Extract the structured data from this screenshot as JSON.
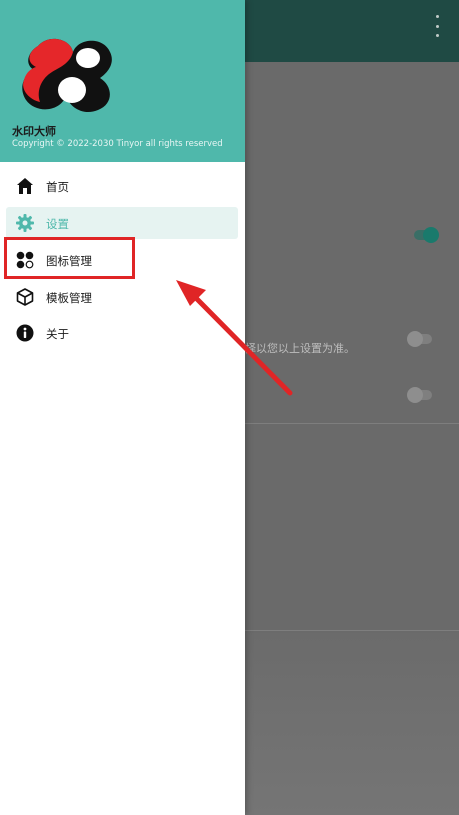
{
  "background": {
    "description_text": "择以您以上设置为准。"
  },
  "drawer": {
    "app_name": "水印大师",
    "copyright": "Copyright © 2022-2030 Tinyor all rights reserved",
    "menu": [
      {
        "label": "首页",
        "icon": "home-icon",
        "active": false
      },
      {
        "label": "设置",
        "icon": "gear-icon",
        "active": true
      },
      {
        "label": "图标管理",
        "icon": "icon-manage-icon",
        "active": false
      },
      {
        "label": "模板管理",
        "icon": "template-cube-icon",
        "active": false
      },
      {
        "label": "关于",
        "icon": "info-icon",
        "active": false
      }
    ]
  },
  "colors": {
    "header": "#4fb8ab",
    "accent": "#4fb8ab",
    "annotation": "#e02526",
    "toolbar": "#1f4a44"
  }
}
